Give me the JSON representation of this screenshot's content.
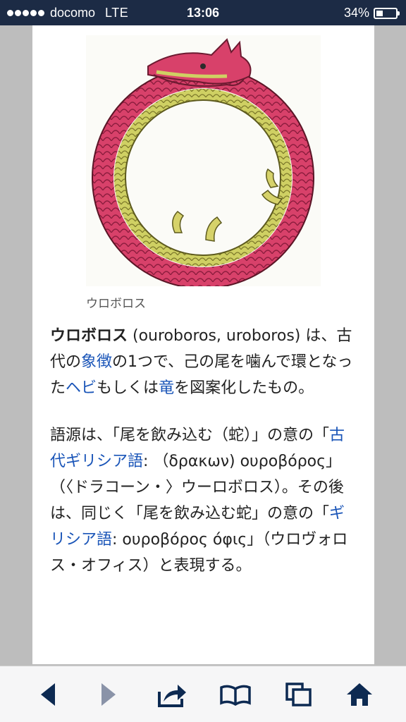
{
  "status_bar": {
    "carrier": "docomo",
    "network": "LTE",
    "time": "13:06",
    "battery": "34%",
    "battery_level": 0.34
  },
  "figure": {
    "image_subject": "ouroboros-dragon-illustration",
    "caption": "ウロボロス"
  },
  "article": {
    "p1": {
      "term": "ウロボロス",
      "t1": " (ouroboros, uroboros) は、古代の",
      "link1": "象徴",
      "t2": "の1つで、己の尾を噛んで環となった",
      "link2": "ヘビ",
      "t3": "もしくは",
      "link3": "竜",
      "t4": "を図案化したもの。"
    },
    "p2": {
      "t1": "語源は、「尾を飲み込む（蛇）」の意の「",
      "link1": "古代ギリシア語",
      "t2": ": （δρακων) ουροβόρος」（〈ドラコーン・〉ウーロボロス）。その後は、同じく「尾を飲み込む蛇」の意の「",
      "link2": "ギリシア語",
      "t3": ": ουροβόρος όφις」（ウロヴォロス・オフィス）と表現する。"
    }
  },
  "toolbar": {
    "back": "back-icon",
    "forward": "forward-icon",
    "share": "share-icon",
    "bookmarks": "bookmarks-icon",
    "tabs": "tabs-icon",
    "home": "home-icon"
  },
  "colors": {
    "status_bar_bg": "#1c2b45",
    "link": "#1a55b8",
    "toolbar_icon": "#0d2a52",
    "toolbar_icon_disabled": "#8a93a8"
  }
}
